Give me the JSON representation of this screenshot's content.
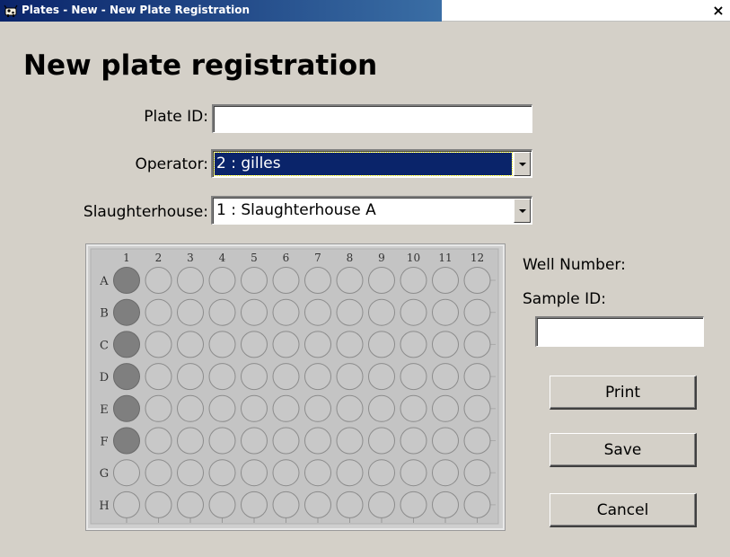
{
  "window": {
    "title": "Plates - New - New Plate Registration",
    "close_glyph": "×"
  },
  "heading": "New plate registration",
  "form": {
    "plate_id_label": "Plate ID:",
    "plate_id_value": "",
    "operator_label": "Operator:",
    "operator_value": "2 : gilles",
    "slaughterhouse_label": "Slaughterhouse:",
    "slaughterhouse_value": "1 : Slaughterhouse A"
  },
  "plate": {
    "columns": [
      "1",
      "2",
      "3",
      "4",
      "5",
      "6",
      "7",
      "8",
      "9",
      "10",
      "11",
      "12"
    ],
    "rows": [
      "A",
      "B",
      "C",
      "D",
      "E",
      "F",
      "G",
      "H"
    ],
    "filled_wells": [
      "A1",
      "B1",
      "C1",
      "D1",
      "E1",
      "F1"
    ],
    "filled_color": "#7f7f7f",
    "empty_color": "#c8c8c8"
  },
  "side": {
    "well_number_label": "Well Number:",
    "sample_id_label": "Sample ID:",
    "sample_id_value": ""
  },
  "buttons": {
    "print": "Print",
    "save": "Save",
    "cancel": "Cancel"
  },
  "colors": {
    "dialog_bg": "#d4d0c8",
    "title_gradient_start": "#0a246a",
    "title_gradient_end": "#3a6ea5",
    "selection_bg": "#0a246a"
  }
}
